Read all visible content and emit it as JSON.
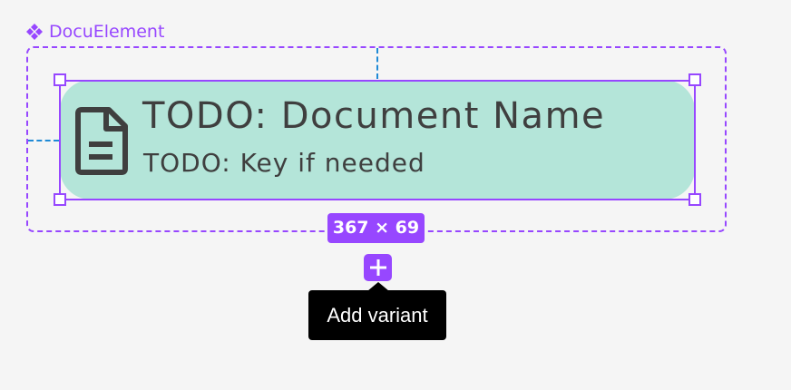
{
  "component": {
    "name": "DocuElement",
    "icon": "component-icon",
    "accent_color": "#9747ff"
  },
  "document": {
    "title": "TODO: Document Name",
    "subtitle": "TODO: Key if needed",
    "icon": "document-icon",
    "fill_color": "#b4e5d9",
    "text_color": "#3f3f3f"
  },
  "selection": {
    "size_label": "367 × 69"
  },
  "actions": {
    "add_icon": "plus-icon",
    "add_variant_tooltip": "Add variant"
  },
  "guides": {
    "color": "#1f8ad6"
  }
}
